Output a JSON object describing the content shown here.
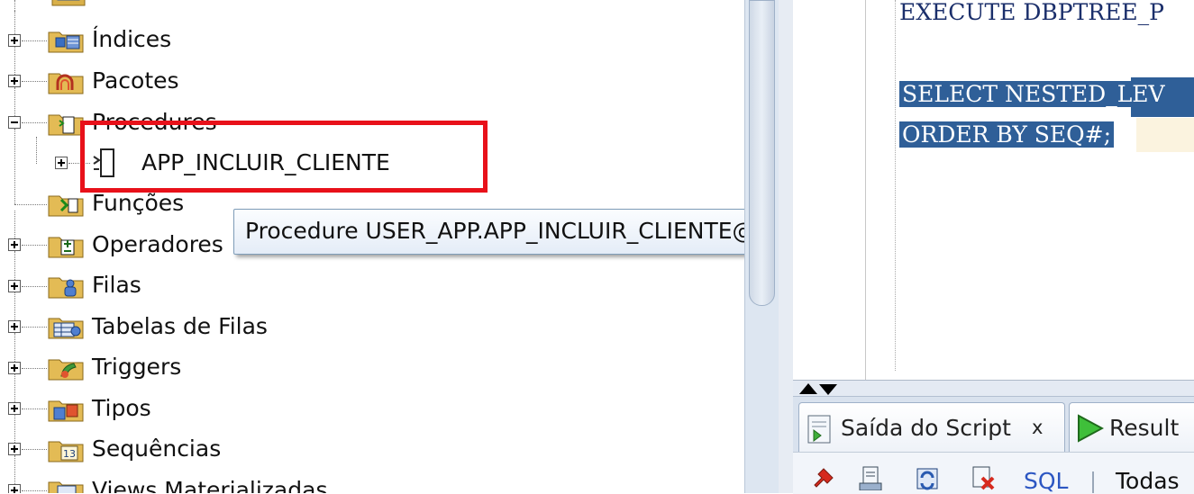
{
  "tree": {
    "items": [
      {
        "label": "Índices",
        "icon": "index-folder-icon",
        "state": "collapsed"
      },
      {
        "label": "Pacotes",
        "icon": "package-folder-icon",
        "state": "collapsed"
      },
      {
        "label": "Procedures",
        "icon": "procedure-folder-icon",
        "state": "expanded"
      },
      {
        "label": "APP_INCLUIR_CLIENTE",
        "icon": "procedure-icon",
        "state": "collapsed",
        "child": true
      },
      {
        "label": "Funções",
        "icon": "function-folder-icon",
        "state": "leaf"
      },
      {
        "label": "Operadores",
        "icon": "operator-folder-icon",
        "state": "collapsed"
      },
      {
        "label": "Filas",
        "icon": "queue-folder-icon",
        "state": "collapsed"
      },
      {
        "label": "Tabelas de Filas",
        "icon": "queue-table-folder-icon",
        "state": "collapsed"
      },
      {
        "label": "Triggers",
        "icon": "trigger-folder-icon",
        "state": "collapsed"
      },
      {
        "label": "Tipos",
        "icon": "type-folder-icon",
        "state": "collapsed"
      },
      {
        "label": "Sequências",
        "icon": "sequence-folder-icon",
        "state": "collapsed"
      },
      {
        "label": "Views Materializadas",
        "icon": "materialized-view-folder-icon",
        "state": "collapsed"
      }
    ]
  },
  "tooltip": {
    "text": "Procedure USER_APP.APP_INCLUIR_CLIENTE@user_app"
  },
  "editor": {
    "lines": [
      "EXECUTE DBPTREE_P",
      "SELECT NESTED_LEV",
      "ORDER BY SEQ#;"
    ]
  },
  "dock": {
    "tabs": [
      {
        "label": "Saída do Script",
        "close": "x",
        "icon": "script-output-icon"
      },
      {
        "label": "Result",
        "icon": "run-icon"
      }
    ],
    "toolbar": {
      "sql_label": "SQL",
      "filter_label": "Todas"
    }
  },
  "colors": {
    "highlight": "#e8111a",
    "selection": "#2f5f98",
    "tooltip_border": "#7f9db9"
  }
}
